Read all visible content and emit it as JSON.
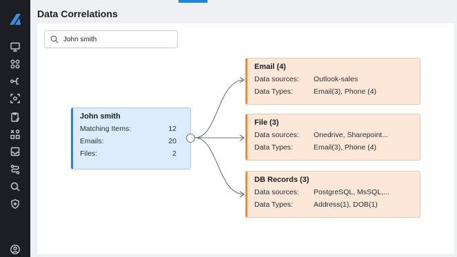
{
  "page": {
    "title": "Data Correlations"
  },
  "colors": {
    "sidebar": "#1c1e23",
    "accent": "#1f86d6",
    "source_fill": "#dcecfb",
    "source_border": "#2b7fd6",
    "target_fill": "#fde7d9",
    "target_border": "#ef8a2d"
  },
  "sidebar": {
    "icons": [
      "logo-icon",
      "monitor-icon",
      "grid-icon",
      "share-icon",
      "face-scan-icon",
      "clipboard-check-icon",
      "shapes-icon",
      "inbox-icon",
      "route-icon",
      "search-zoom-icon",
      "shield-icon",
      "user-icon"
    ]
  },
  "search": {
    "value": "John smith",
    "icon": "search-icon"
  },
  "source": {
    "name": "John smith",
    "rows": [
      {
        "label": "Matching Items:",
        "value": "12"
      },
      {
        "label": "Emails:",
        "value": "20"
      },
      {
        "label": "Files:",
        "value": "2"
      }
    ]
  },
  "targets": [
    {
      "title": "Email (4)",
      "sources_label": "Data sources:",
      "sources": "Outlook-sales",
      "types_label": "Data Types:",
      "types": "Email(3), Phone (4)"
    },
    {
      "title": "File (3)",
      "sources_label": "Data sources:",
      "sources": "Onedrive, Sharepoint...",
      "types_label": "Data Types:",
      "types": "Email(3), Phone (4)"
    },
    {
      "title": "DB Records (3)",
      "sources_label": "Data sources:",
      "sources": "PostgreSQL, MsSQL,...",
      "types_label": "Data Types:",
      "types": "Address(1), DOB(1)"
    }
  ]
}
